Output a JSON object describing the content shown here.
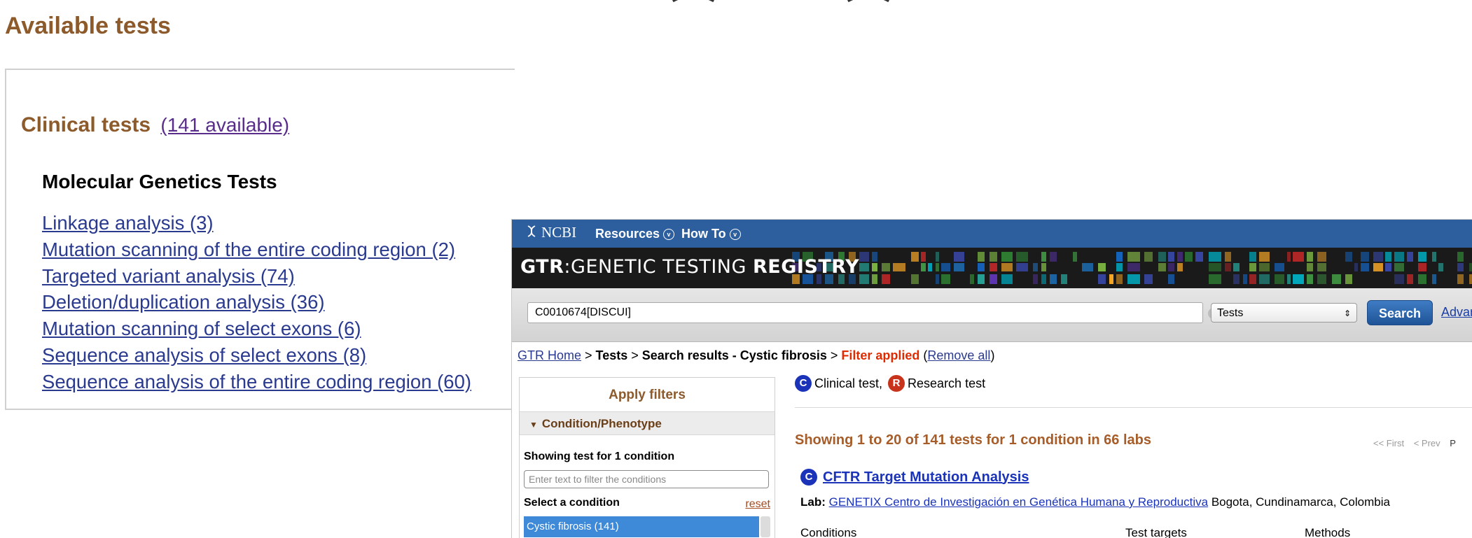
{
  "left_panel": {
    "title": "Available tests",
    "clinical_heading": "Clinical tests",
    "clinical_count_link": "(141 available)",
    "molecular_heading": "Molecular Genetics Tests",
    "tests": [
      "Linkage analysis (3)",
      "Mutation scanning of the entire coding region (2)",
      "Targeted variant analysis (74)",
      "Deletion/duplication analysis (36)",
      "Mutation scanning of select exons (6)",
      "Sequence analysis of select exons (8)",
      "Sequence analysis of the entire coding region (60)"
    ]
  },
  "gtr": {
    "ncbi_bar": {
      "logo_text": "NCBI",
      "menus": [
        "Resources",
        "How To"
      ]
    },
    "banner": {
      "logo_left": "GTR",
      "logo_sep": ":",
      "logo_right_light": "GENETIC TESTING ",
      "logo_right_bold": "REGISTRY"
    },
    "search": {
      "query": "C0010674[DISCUI]",
      "database": "Tests",
      "button": "Search",
      "advanced": "Advanced"
    },
    "breadcrumb": {
      "home": "GTR Home",
      "sep": " > ",
      "tests": "Tests",
      "current": "Search results - Cystic fibrosis",
      "filter": "Filter applied",
      "remove_open": " (",
      "remove": "Remove all",
      "remove_close": ")"
    },
    "sidebar": {
      "title": "Apply filters",
      "section": "Condition/Phenotype",
      "showing": "Showing test for 1 condition",
      "filter_placeholder": "Enter text to filter the conditions",
      "select_label": "Select a condition",
      "reset": "reset",
      "selected_item": "Cystic fibrosis (141)"
    },
    "legend": {
      "clinical_badge": "C",
      "clinical_label": "Clinical test,",
      "research_badge": "R",
      "research_label": "Research test"
    },
    "results": {
      "summary": "Showing 1 to 20 of 141 tests for 1 condition in 66 labs",
      "pager_first": "<< First",
      "pager_prev": "< Prev",
      "pager_cut": "P",
      "first": {
        "badge": "C",
        "title": "CFTR Target Mutation Analysis",
        "lab_label": "Lab:",
        "lab_name": "GENETIX Centro de Investigación en Genética Humana y Reproductiva",
        "lab_location": "Bogota, Cundinamarca, Colombia"
      },
      "columns": [
        "Conditions",
        "Test targets",
        "Methods"
      ]
    }
  }
}
